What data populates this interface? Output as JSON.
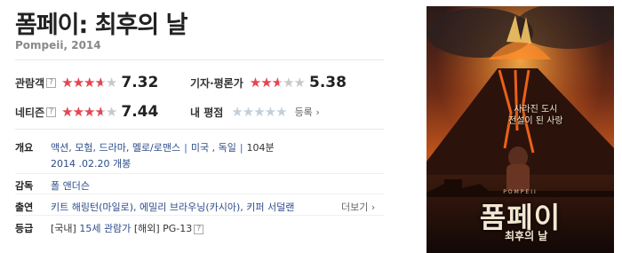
{
  "movie": {
    "title": "폼페이: 최후의 날",
    "original_title": "Pompeii, 2014"
  },
  "ratings": {
    "audience": {
      "label": "관람객",
      "score": "7.32",
      "fill_pct": 73.2
    },
    "critics": {
      "label": "기자·평론가",
      "score": "5.38",
      "fill_pct": 53.8
    },
    "netizen": {
      "label": "네티즌",
      "score": "7.44",
      "fill_pct": 74.4
    },
    "mine": {
      "label": "내 평점",
      "register": "등록",
      "fill_pct": 0
    }
  },
  "info": {
    "overview": {
      "label": "개요",
      "genres": "액션, 모험, 드라마, 멜로/로맨스",
      "countries": "미국 , 독일",
      "runtime": "104분",
      "release": "2014 .02.20 개봉"
    },
    "director": {
      "label": "감독",
      "name": "폴 앤더슨"
    },
    "cast": {
      "label": "출연",
      "actors": "키트 해링턴(마일로), 에밀리 브라우닝(카시아), 키퍼 서덜랜",
      "more": "더보기"
    },
    "grade": {
      "label": "등급",
      "domestic_tag": "[국내]",
      "domestic": "15세 관람가",
      "foreign_tag": "[해외]",
      "foreign": "PG-13"
    }
  },
  "poster": {
    "tagline_1": "사라진 도시",
    "tagline_2": "전설이 된 사랑",
    "small_brand": "POMPEII",
    "title": "폼페이",
    "subtitle": "최후의 날"
  },
  "icons": {
    "help": "question-box-icon",
    "star": "star-icon",
    "chevron": "chevron-right-icon"
  },
  "colors": {
    "star_filled": "#e84451",
    "star_empty": "#c8c8c8",
    "link": "#2d4d8a",
    "separator": "#3b63b4"
  }
}
